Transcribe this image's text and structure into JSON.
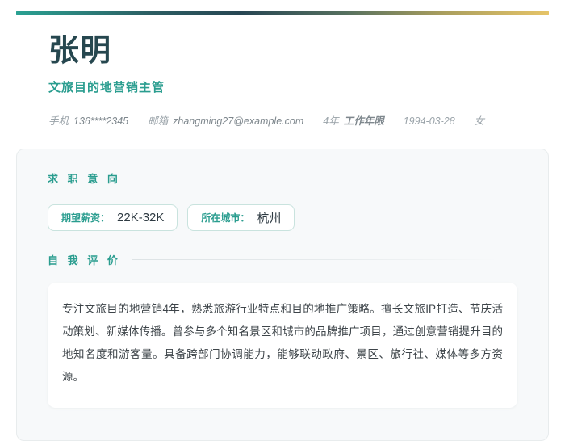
{
  "theme": {
    "accent_teal": "#2a9d8f",
    "dark_slate": "#26474f",
    "gold": "#e6c468",
    "gradient_bar": [
      "#2aa192",
      "#274653",
      "#e6c468"
    ]
  },
  "header": {
    "name": "张明",
    "job_title": "文旅目的地营销主管",
    "contact": {
      "phone_label": "手机",
      "phone_value": "136****2345",
      "email_label": "邮箱",
      "email_value": "zhangming27@example.com",
      "experience_value": "4年",
      "experience_label": "工作年限",
      "birth_date": "1994-03-28",
      "gender": "女"
    }
  },
  "sections": {
    "job_intent": {
      "heading": "求 职 意 向",
      "pills": [
        {
          "label": "期望薪资：",
          "value": "22K-32K"
        },
        {
          "label": "所在城市：",
          "value": "杭州"
        }
      ]
    },
    "self_evaluation": {
      "heading": "自 我 评 价",
      "paragraph": "专注文旅目的地营销4年，熟悉旅游行业特点和目的地推广策略。擅长文旅IP打造、节庆活动策划、新媒体传播。曾参与多个知名景区和城市的品牌推广项目，通过创意营销提升目的地知名度和游客量。具备跨部门协调能力，能够联动政府、景区、旅行社、媒体等多方资源。"
    }
  }
}
